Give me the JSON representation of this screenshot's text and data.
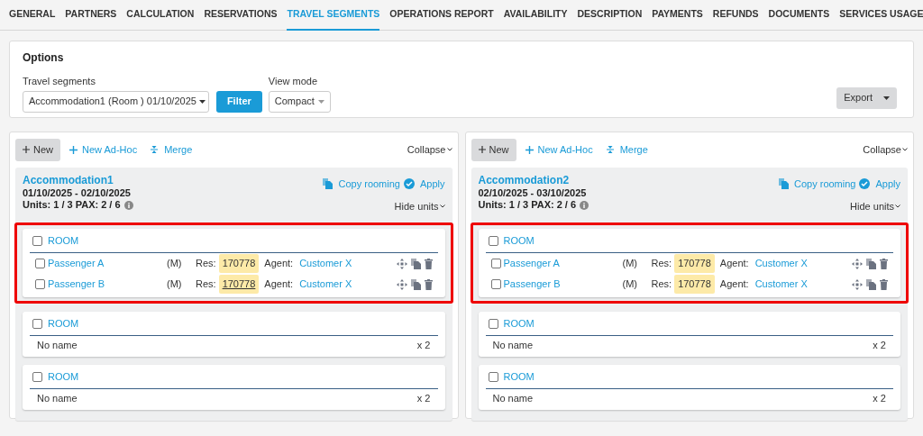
{
  "tabs": [
    {
      "label": "GENERAL",
      "selected": false
    },
    {
      "label": "PARTNERS",
      "selected": false
    },
    {
      "label": "CALCULATION",
      "selected": false
    },
    {
      "label": "RESERVATIONS",
      "selected": false
    },
    {
      "label": "TRAVEL SEGMENTS",
      "selected": true
    },
    {
      "label": "OPERATIONS REPORT",
      "selected": false
    },
    {
      "label": "AVAILABILITY",
      "selected": false
    },
    {
      "label": "DESCRIPTION",
      "selected": false
    },
    {
      "label": "PAYMENTS",
      "selected": false
    },
    {
      "label": "REFUNDS",
      "selected": false
    },
    {
      "label": "DOCUMENTS",
      "selected": false
    },
    {
      "label": "SERVICES USAGE",
      "selected": false
    }
  ],
  "options": {
    "title": "Options",
    "travel_segments": {
      "label": "Travel segments",
      "value": "Accommodation1 (Room ) 01/10/2025"
    },
    "filter_button": "Filter",
    "view_mode": {
      "label": "View mode",
      "value": "Compact"
    },
    "export_button": "Export"
  },
  "panels": [
    {
      "toolbar": {
        "new": "New",
        "new_adhoc": "New Ad-Hoc",
        "merge": "Merge",
        "collapse": "Collapse"
      },
      "segment": {
        "title": "Accommodation1",
        "dates": "01/10/2025 - 02/10/2025",
        "units": "Units: 1 / 3 PAX: 2 / 6",
        "copy_rooming": "Copy rooming",
        "apply": "Apply",
        "hide_units": "Hide units"
      },
      "rooms": [
        {
          "highlighted": true,
          "checked": false,
          "label": "ROOM",
          "passengers": [
            {
              "checked": false,
              "name": "Passenger A",
              "gender": "(M)",
              "res_label": "Res:",
              "res": "170778",
              "res_underlined": false,
              "agent_label": "Agent:",
              "agent": "Customer X"
            },
            {
              "checked": false,
              "name": "Passenger B",
              "gender": "(M)",
              "res_label": "Res:",
              "res": "170778",
              "res_underlined": true,
              "agent_label": "Agent:",
              "agent": "Customer X"
            }
          ]
        },
        {
          "highlighted": false,
          "checked": false,
          "label": "ROOM",
          "unnamed": {
            "name": "No name",
            "count": "x 2"
          }
        },
        {
          "highlighted": false,
          "checked": false,
          "label": "ROOM",
          "unnamed": {
            "name": "No name",
            "count": "x 2"
          }
        }
      ]
    },
    {
      "toolbar": {
        "new": "New",
        "new_adhoc": "New Ad-Hoc",
        "merge": "Merge",
        "collapse": "Collapse"
      },
      "segment": {
        "title": "Accommodation2",
        "dates": "02/10/2025 - 03/10/2025",
        "units": "Units: 1 / 3 PAX: 2 / 6",
        "copy_rooming": "Copy rooming",
        "apply": "Apply",
        "hide_units": "Hide units"
      },
      "rooms": [
        {
          "highlighted": true,
          "checked": false,
          "label": "ROOM",
          "passengers": [
            {
              "checked": false,
              "name": "Passenger A",
              "gender": "(M)",
              "res_label": "Res:",
              "res": "170778",
              "res_underlined": false,
              "agent_label": "Agent:",
              "agent": "Customer X"
            },
            {
              "checked": false,
              "name": "Passenger B",
              "gender": "(M)",
              "res_label": "Res:",
              "res": "170778",
              "res_underlined": false,
              "agent_label": "Agent:",
              "agent": "Customer X"
            }
          ]
        },
        {
          "highlighted": false,
          "checked": false,
          "label": "ROOM",
          "unnamed": {
            "name": "No name",
            "count": "x 2"
          }
        },
        {
          "highlighted": false,
          "checked": false,
          "label": "ROOM",
          "unnamed": {
            "name": "No name",
            "count": "x 2"
          }
        }
      ]
    }
  ]
}
